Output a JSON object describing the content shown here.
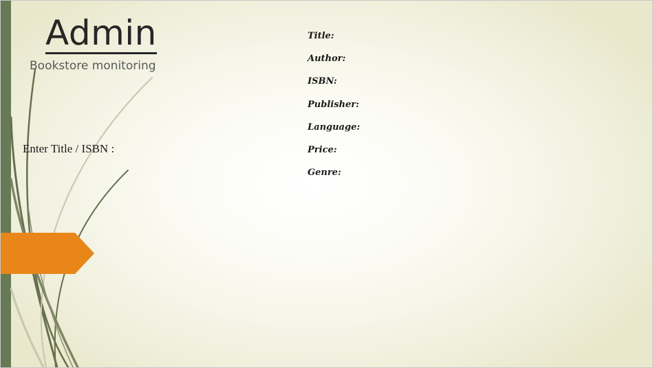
{
  "header": {
    "title": "Admin",
    "subtitle": "Bookstore monitoring"
  },
  "search": {
    "label": "Enter Title / ISBN :"
  },
  "details": {
    "fields": [
      "Title:",
      "Author:",
      "ISBN:",
      "Publisher:",
      "Language:",
      "Price:",
      "Genre:"
    ]
  },
  "theme": {
    "bar_color": "#667a55",
    "arrow_color": "#e8861a",
    "grass_color": "#66704e"
  }
}
